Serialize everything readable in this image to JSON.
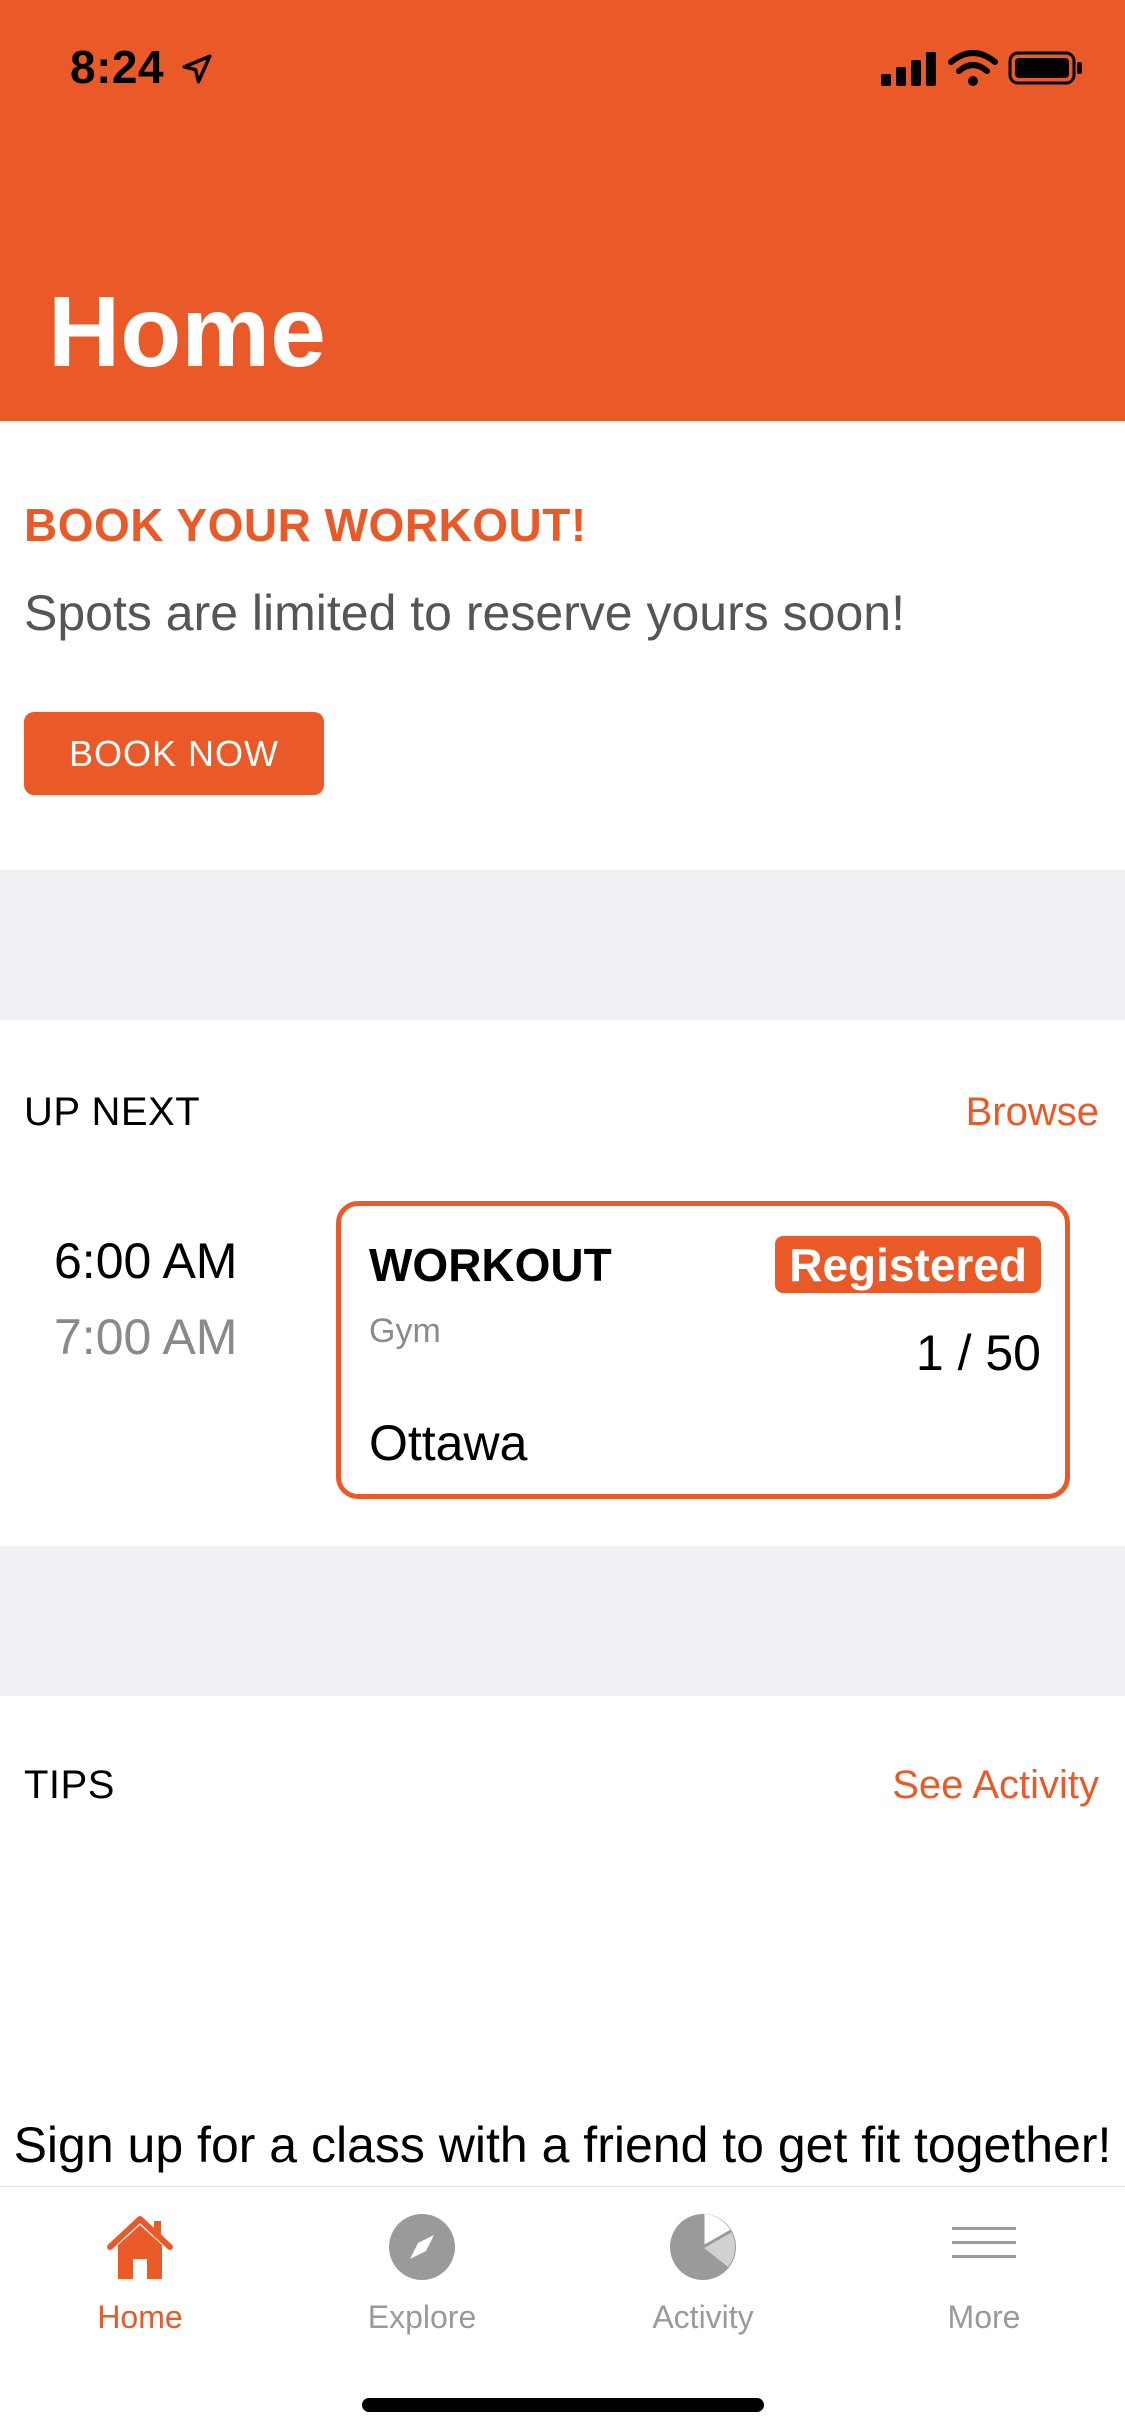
{
  "status_bar": {
    "time": "8:24"
  },
  "header": {
    "title": "Home"
  },
  "promo": {
    "title": "BOOK YOUR WORKOUT!",
    "subtitle": "Spots are limited to reserve yours soon!",
    "button_label": "BOOK NOW"
  },
  "up_next": {
    "section_label": "UP NEXT",
    "link_label": "Browse",
    "class": {
      "start_time": "6:00 AM",
      "end_time": "7:00 AM",
      "name": "WORKOUT",
      "status": "Registered",
      "category": "Gym",
      "capacity": "1 / 50",
      "location": "Ottawa"
    }
  },
  "tips": {
    "section_label": "TIPS",
    "link_label": "See Activity",
    "text": "Sign up for a class with a friend to get fit together!"
  },
  "tabbar": {
    "items": [
      {
        "label": "Home",
        "icon": "home-icon",
        "active": true
      },
      {
        "label": "Explore",
        "icon": "compass-icon",
        "active": false
      },
      {
        "label": "Activity",
        "icon": "pie-chart-icon",
        "active": false
      },
      {
        "label": "More",
        "icon": "menu-icon",
        "active": false
      }
    ]
  },
  "colors": {
    "accent": "#EA5A29",
    "separator": "#F1F1F5",
    "inactive": "#9A9A9A"
  }
}
